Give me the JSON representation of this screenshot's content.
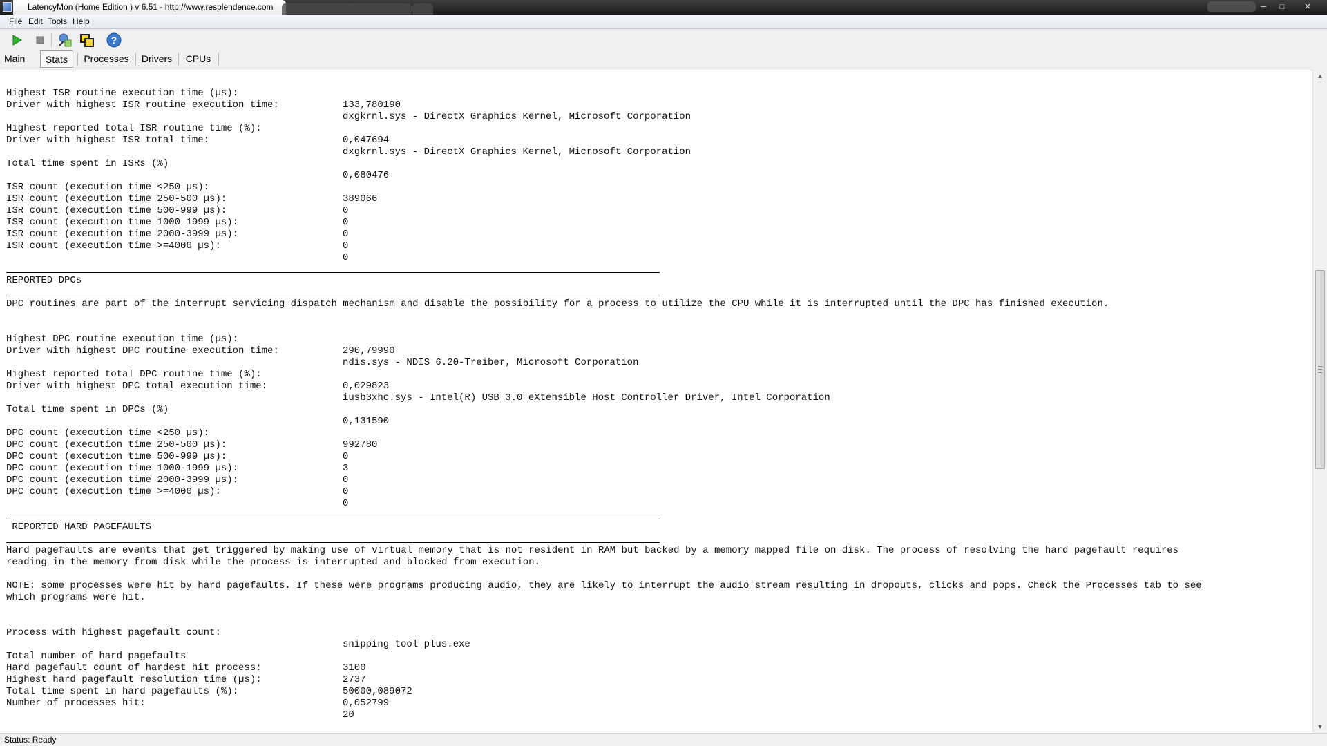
{
  "window": {
    "title": "LatencyMon  (Home Edition )  v 6.51 - http://www.resplendence.com"
  },
  "menu": {
    "file": "File",
    "edit": "Edit",
    "tools": "Tools",
    "help": "Help"
  },
  "toolbar": {
    "icons": [
      "play-icon",
      "stop-icon",
      "processes-icon",
      "windows-icon",
      "help-icon"
    ]
  },
  "tabs": {
    "main": "Main",
    "stats": "Stats",
    "processes": "Processes",
    "drivers": "Drivers",
    "cpus": "CPUs"
  },
  "isr": {
    "highest_exec_label": "Highest ISR routine execution time (µs):",
    "highest_exec_value": "133,780190",
    "driver_highest_exec_label": "Driver with highest ISR routine execution time:",
    "driver_highest_exec_value": "dxgkrnl.sys - DirectX Graphics Kernel, Microsoft Corporation",
    "highest_total_label": "Highest reported total ISR routine time (%):",
    "highest_total_value": "0,047694",
    "driver_highest_total_label": "Driver with highest ISR total time:",
    "driver_highest_total_value": "dxgkrnl.sys - DirectX Graphics Kernel, Microsoft Corporation",
    "total_time_label": "Total time spent in ISRs (%)",
    "total_time_value": "0,080476",
    "counts": [
      {
        "label": "ISR count (execution time <250 µs):",
        "value": "389066"
      },
      {
        "label": "ISR count (execution time 250-500 µs):",
        "value": "0"
      },
      {
        "label": "ISR count (execution time 500-999 µs):",
        "value": "0"
      },
      {
        "label": "ISR count (execution time 1000-1999 µs):",
        "value": "0"
      },
      {
        "label": "ISR count (execution time 2000-3999 µs):",
        "value": "0"
      },
      {
        "label": "ISR count (execution time >=4000 µs):",
        "value": "0"
      }
    ]
  },
  "dpc": {
    "header": "REPORTED DPCs",
    "description": "DPC routines are part of the interrupt servicing dispatch mechanism and disable the possibility for a process to utilize the CPU while it is interrupted until the DPC has finished execution.",
    "highest_exec_label": "Highest DPC routine execution time (µs):",
    "highest_exec_value": "290,79990",
    "driver_highest_exec_label": "Driver with highest DPC routine execution time:",
    "driver_highest_exec_value": "ndis.sys - NDIS 6.20-Treiber, Microsoft Corporation",
    "highest_total_label": "Highest reported total DPC routine time (%):",
    "highest_total_value": "0,029823",
    "driver_highest_total_label": "Driver with highest DPC total execution time:",
    "driver_highest_total_value": "iusb3xhc.sys - Intel(R) USB 3.0 eXtensible Host Controller Driver, Intel Corporation",
    "total_time_label": "Total time spent in DPCs (%)",
    "total_time_value": "0,131590",
    "counts": [
      {
        "label": "DPC count (execution time <250 µs):",
        "value": "992780"
      },
      {
        "label": "DPC count (execution time 250-500 µs):",
        "value": "0"
      },
      {
        "label": "DPC count (execution time 500-999 µs):",
        "value": "3"
      },
      {
        "label": "DPC count (execution time 1000-1999 µs):",
        "value": "0"
      },
      {
        "label": "DPC count (execution time 2000-3999 µs):",
        "value": "0"
      },
      {
        "label": "DPC count (execution time >=4000 µs):",
        "value": "0"
      }
    ]
  },
  "pagefaults": {
    "header": " REPORTED HARD PAGEFAULTS",
    "description_line1": "Hard pagefaults are events that get triggered by making use of virtual memory that is not resident in RAM but backed by a memory mapped file on disk. The process of resolving the hard pagefault requires",
    "description_line2": "reading in the memory from disk while the process is interrupted and blocked from execution.",
    "note_line1": "NOTE: some processes were hit by hard pagefaults. If these were programs producing audio, they are likely to interrupt the audio stream resulting in dropouts, clicks and pops. Check the Processes tab to see",
    "note_line2": "which programs were hit.",
    "highest_process_label": "Process with highest pagefault count:",
    "highest_process_value": "snipping tool plus.exe",
    "stats": [
      {
        "label": "Total number of hard pagefaults",
        "value": "3100"
      },
      {
        "label": "Hard pagefault count of hardest hit process:",
        "value": "2737"
      },
      {
        "label": "Highest hard pagefault resolution time (µs):",
        "value": "50000,089072"
      },
      {
        "label": "Total time spent in hard pagefaults (%):",
        "value": "0,052799"
      },
      {
        "label": "Number of processes hit:",
        "value": "20"
      }
    ]
  },
  "status": {
    "text": "Status: Ready"
  }
}
